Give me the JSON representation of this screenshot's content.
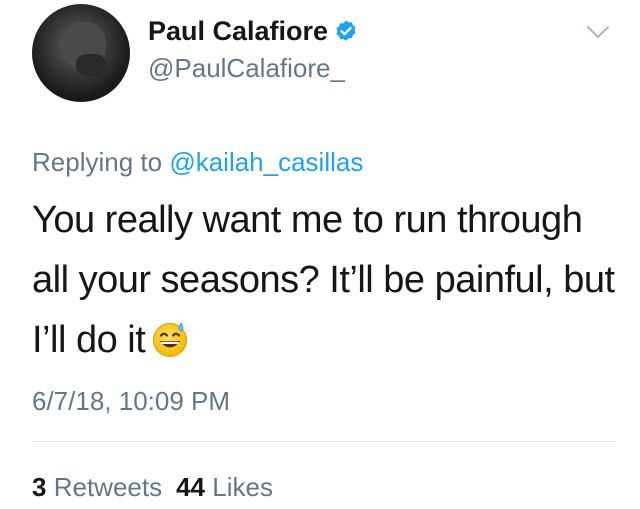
{
  "tweet": {
    "author": {
      "display_name": "Paul Calafiore",
      "handle": "@PaulCalafiore_",
      "verified": true,
      "verified_icon": "verified-badge-icon",
      "avatar_icon": "profile-photo"
    },
    "reply": {
      "prefix": "Replying to ",
      "mention": "@kailah_casillas"
    },
    "text": "You really want me to run through all your seasons? It’ll be painful, but I’ll do it",
    "emoji": "grinning-face-with-sweat-icon",
    "timestamp": "6/7/18, 10:09 PM",
    "stats": {
      "retweets_count": "3",
      "retweets_label": "Retweets",
      "likes_count": "44",
      "likes_label": "Likes"
    },
    "menu_icon": "chevron-down-icon"
  },
  "colors": {
    "text_primary": "#14171a",
    "text_secondary": "#657786",
    "link_blue": "#1da1f2",
    "divider": "#e1e8ed"
  }
}
